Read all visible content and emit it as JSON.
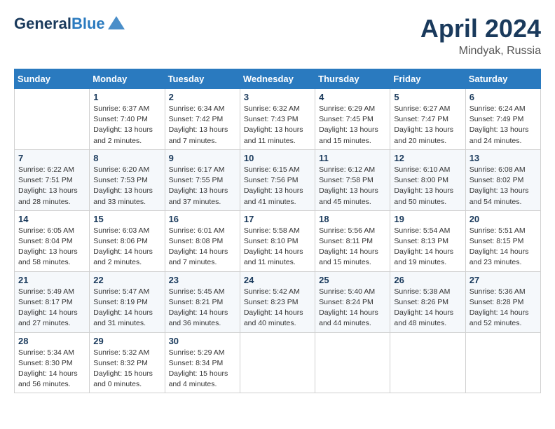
{
  "header": {
    "logo_line1": "General",
    "logo_line2": "Blue",
    "month_title": "April 2024",
    "location": "Mindyak, Russia"
  },
  "days_of_week": [
    "Sunday",
    "Monday",
    "Tuesday",
    "Wednesday",
    "Thursday",
    "Friday",
    "Saturday"
  ],
  "weeks": [
    [
      {
        "day": "",
        "info": ""
      },
      {
        "day": "1",
        "info": "Sunrise: 6:37 AM\nSunset: 7:40 PM\nDaylight: 13 hours\nand 2 minutes."
      },
      {
        "day": "2",
        "info": "Sunrise: 6:34 AM\nSunset: 7:42 PM\nDaylight: 13 hours\nand 7 minutes."
      },
      {
        "day": "3",
        "info": "Sunrise: 6:32 AM\nSunset: 7:43 PM\nDaylight: 13 hours\nand 11 minutes."
      },
      {
        "day": "4",
        "info": "Sunrise: 6:29 AM\nSunset: 7:45 PM\nDaylight: 13 hours\nand 15 minutes."
      },
      {
        "day": "5",
        "info": "Sunrise: 6:27 AM\nSunset: 7:47 PM\nDaylight: 13 hours\nand 20 minutes."
      },
      {
        "day": "6",
        "info": "Sunrise: 6:24 AM\nSunset: 7:49 PM\nDaylight: 13 hours\nand 24 minutes."
      }
    ],
    [
      {
        "day": "7",
        "info": "Sunrise: 6:22 AM\nSunset: 7:51 PM\nDaylight: 13 hours\nand 28 minutes."
      },
      {
        "day": "8",
        "info": "Sunrise: 6:20 AM\nSunset: 7:53 PM\nDaylight: 13 hours\nand 33 minutes."
      },
      {
        "day": "9",
        "info": "Sunrise: 6:17 AM\nSunset: 7:55 PM\nDaylight: 13 hours\nand 37 minutes."
      },
      {
        "day": "10",
        "info": "Sunrise: 6:15 AM\nSunset: 7:56 PM\nDaylight: 13 hours\nand 41 minutes."
      },
      {
        "day": "11",
        "info": "Sunrise: 6:12 AM\nSunset: 7:58 PM\nDaylight: 13 hours\nand 45 minutes."
      },
      {
        "day": "12",
        "info": "Sunrise: 6:10 AM\nSunset: 8:00 PM\nDaylight: 13 hours\nand 50 minutes."
      },
      {
        "day": "13",
        "info": "Sunrise: 6:08 AM\nSunset: 8:02 PM\nDaylight: 13 hours\nand 54 minutes."
      }
    ],
    [
      {
        "day": "14",
        "info": "Sunrise: 6:05 AM\nSunset: 8:04 PM\nDaylight: 13 hours\nand 58 minutes."
      },
      {
        "day": "15",
        "info": "Sunrise: 6:03 AM\nSunset: 8:06 PM\nDaylight: 14 hours\nand 2 minutes."
      },
      {
        "day": "16",
        "info": "Sunrise: 6:01 AM\nSunset: 8:08 PM\nDaylight: 14 hours\nand 7 minutes."
      },
      {
        "day": "17",
        "info": "Sunrise: 5:58 AM\nSunset: 8:10 PM\nDaylight: 14 hours\nand 11 minutes."
      },
      {
        "day": "18",
        "info": "Sunrise: 5:56 AM\nSunset: 8:11 PM\nDaylight: 14 hours\nand 15 minutes."
      },
      {
        "day": "19",
        "info": "Sunrise: 5:54 AM\nSunset: 8:13 PM\nDaylight: 14 hours\nand 19 minutes."
      },
      {
        "day": "20",
        "info": "Sunrise: 5:51 AM\nSunset: 8:15 PM\nDaylight: 14 hours\nand 23 minutes."
      }
    ],
    [
      {
        "day": "21",
        "info": "Sunrise: 5:49 AM\nSunset: 8:17 PM\nDaylight: 14 hours\nand 27 minutes."
      },
      {
        "day": "22",
        "info": "Sunrise: 5:47 AM\nSunset: 8:19 PM\nDaylight: 14 hours\nand 31 minutes."
      },
      {
        "day": "23",
        "info": "Sunrise: 5:45 AM\nSunset: 8:21 PM\nDaylight: 14 hours\nand 36 minutes."
      },
      {
        "day": "24",
        "info": "Sunrise: 5:42 AM\nSunset: 8:23 PM\nDaylight: 14 hours\nand 40 minutes."
      },
      {
        "day": "25",
        "info": "Sunrise: 5:40 AM\nSunset: 8:24 PM\nDaylight: 14 hours\nand 44 minutes."
      },
      {
        "day": "26",
        "info": "Sunrise: 5:38 AM\nSunset: 8:26 PM\nDaylight: 14 hours\nand 48 minutes."
      },
      {
        "day": "27",
        "info": "Sunrise: 5:36 AM\nSunset: 8:28 PM\nDaylight: 14 hours\nand 52 minutes."
      }
    ],
    [
      {
        "day": "28",
        "info": "Sunrise: 5:34 AM\nSunset: 8:30 PM\nDaylight: 14 hours\nand 56 minutes."
      },
      {
        "day": "29",
        "info": "Sunrise: 5:32 AM\nSunset: 8:32 PM\nDaylight: 15 hours\nand 0 minutes."
      },
      {
        "day": "30",
        "info": "Sunrise: 5:29 AM\nSunset: 8:34 PM\nDaylight: 15 hours\nand 4 minutes."
      },
      {
        "day": "",
        "info": ""
      },
      {
        "day": "",
        "info": ""
      },
      {
        "day": "",
        "info": ""
      },
      {
        "day": "",
        "info": ""
      }
    ]
  ]
}
